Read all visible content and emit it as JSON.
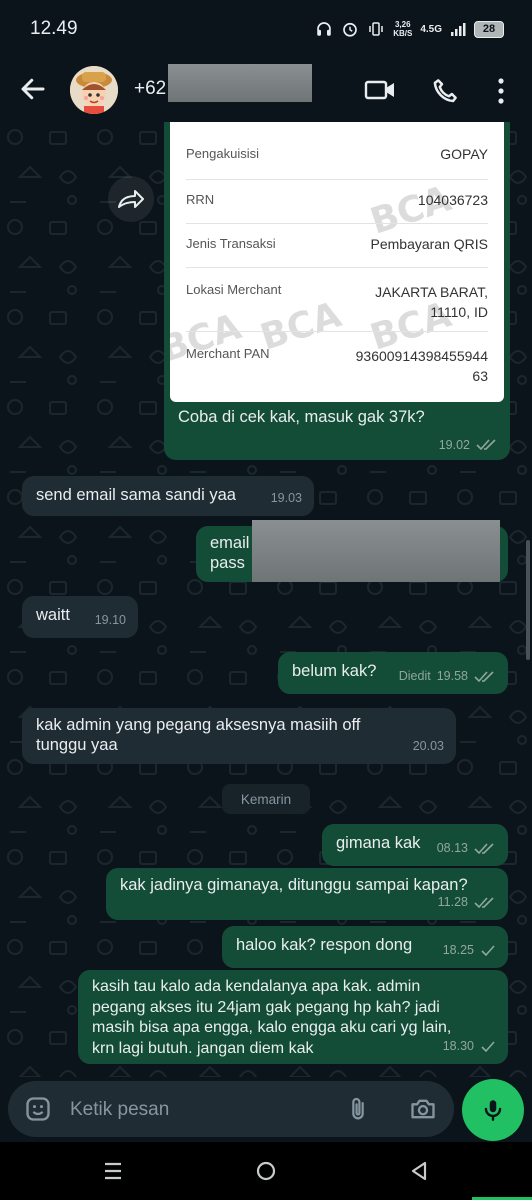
{
  "status_bar": {
    "time": "12.49",
    "net_speed_value": "3,26",
    "net_speed_unit": "KB/S",
    "network": "4.5G",
    "battery": "28"
  },
  "header": {
    "contact_prefix": "+62"
  },
  "receipt": {
    "watermark": "BCA",
    "rows": [
      {
        "label": "Pengakuisisi",
        "value": "GOPAY"
      },
      {
        "label": "RRN",
        "value": "104036723"
      },
      {
        "label": "Jenis Transaksi",
        "value": "Pembayaran QRIS"
      },
      {
        "label": "Lokasi Merchant",
        "value_line1": "JAKARTA BARAT,",
        "value_line2": "11110, ID"
      },
      {
        "label": "Merchant PAN",
        "value_line1": "93600914398455944",
        "value_line2": "63"
      }
    ]
  },
  "messages": [
    {
      "text": "Coba di cek kak, masuk gak 37k?",
      "time": "19.02"
    },
    {
      "text": "send email sama sandi yaa",
      "time": "19.03"
    },
    {
      "line1": "email",
      "line2": "pass"
    },
    {
      "text": "waitt",
      "time": "19.10"
    },
    {
      "text": "belum kak?",
      "edited": "Diedit",
      "time": "19.58"
    },
    {
      "line1": "kak admin yang pegang aksesnya masiih off",
      "line2": "tunggu yaa",
      "time": "20.03"
    },
    {
      "text": "gimana kak",
      "time": "08.13"
    },
    {
      "text": "kak jadinya gimanaya, ditunggu sampai kapan?",
      "time": "11.28"
    },
    {
      "text": "haloo kak? respon dong",
      "time": "18.25"
    },
    {
      "line1": "kasih tau kalo ada kendalanya apa kak. admin",
      "line2": "pegang akses itu 24jam gak pegang hp kah? jadi",
      "line3": "masih bisa apa engga, kalo engga aku cari yg lain,",
      "line4": "krn lagi butuh. jangan diem kak",
      "time": "18.30"
    }
  ],
  "date_separator": "Kemarin",
  "composer": {
    "placeholder": "Ketik pesan"
  },
  "colors": {
    "background": "#0b141a",
    "outgoing_bubble": "#144d37",
    "incoming_bubble": "#1f2c34",
    "accent_green": "#21c063",
    "read_ticks": "#8fa79c"
  },
  "icons": [
    "back-arrow-icon",
    "video-call-icon",
    "phone-icon",
    "more-options-icon",
    "forward-icon",
    "emoji-icon",
    "attach-icon",
    "camera-icon",
    "mic-icon",
    "nav-recents-icon",
    "nav-home-icon",
    "nav-back-icon"
  ]
}
